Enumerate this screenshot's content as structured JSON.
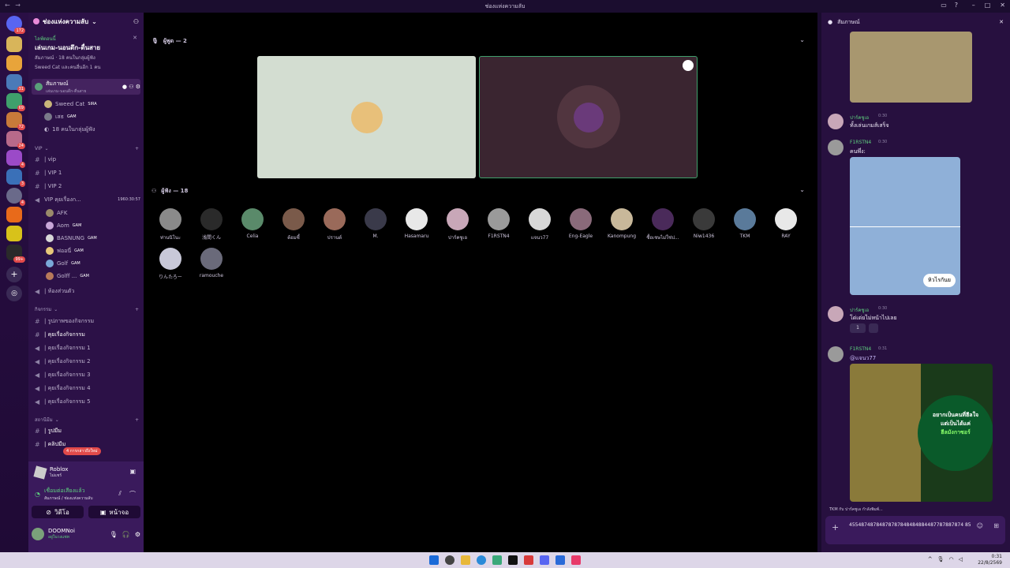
{
  "window": {
    "title": "ช่องแห่งความลับ"
  },
  "server": {
    "name": "ช่องแห่งความลับ",
    "event_tag": "ไลฟ์ตอนนี้",
    "event_title": "เล่นเกม-นอนดึก-ตื่นสาย",
    "event_meta": "สัมภาษณ์ · 18 คนในกลุ่มผู้ฟัง",
    "event_meta2": "Sweed Cat และคนอื่นอีก 1 คน"
  },
  "stage_channel": {
    "name": "สัมภาษณ์",
    "topic": "เล่นเกม-นอนดึก-ตื่นสาย",
    "members": [
      {
        "name": "Sweed Cat",
        "tag": "SIRA"
      },
      {
        "name": "เสธ",
        "tag": "GAM"
      },
      {
        "name": "18 คนในกลุ่มผู้ฟัง",
        "tag": ""
      }
    ]
  },
  "categories": [
    {
      "name": "VIP",
      "channels": [
        "| vip",
        "| VIP 1",
        "| VIP 2"
      ]
    },
    {
      "name": "กิจกรรม",
      "channels": [
        "| รูปภาพของกิจกรรม",
        "| คุยเรื่องกิจกรรม",
        "| คุยเรื่องกิจกรรม 1",
        "| คุยเรื่องกิจกรรม 2",
        "| คุยเรื่องกิจกรรม 3",
        "| คุยเรื่องกิจกรรม 4",
        "| คุยเรื่องกิจกรรม 5"
      ]
    },
    {
      "name": "สถานีมีม",
      "channels": [
        "| รูปมีม",
        "| คลิปมีม"
      ]
    }
  ],
  "vip_voice": {
    "name": "VIP คุยเรื่องก...",
    "timer": "1960:30:57",
    "members": [
      {
        "name": "AFK",
        "tag": ""
      },
      {
        "name": "Aom",
        "tag": "GAM"
      },
      {
        "name": "BASNUNG",
        "tag": "GAM"
      },
      {
        "name": "ฟออนี่",
        "tag": "GAM"
      },
      {
        "name": "Golf",
        "tag": "GAM"
      },
      {
        "name": "Golff ...",
        "tag": "GAM"
      }
    ],
    "private_room": "| ห้องส่วนตัว"
  },
  "new_mentions": "4 การกล่าวถึงใหม่",
  "activity": {
    "game": "Roblox",
    "sub": "ไม่แชร์"
  },
  "voice_status": {
    "title": "เชื่อมต่อเสียงแล้ว",
    "sub": "สัมภาษณ์ / ช่องแห่งความลับ"
  },
  "voice_buttons": {
    "video": "วิดีโอ",
    "screen": "หน้าจอ"
  },
  "user": {
    "name": "DOOMNoi",
    "status": "อยู่ในวงแชท"
  },
  "stage": {
    "speakers_label": "ผู้พูด — 2",
    "listeners_label": "ผู้ฟัง — 18",
    "listeners": [
      "ท่านนิโนะ",
      "浅間くん",
      "Celia",
      "ต้อมซี้",
      "ปรานต์",
      "M.",
      "Hasamaru",
      "ปาร์คชูเอ",
      "F1RSTN4",
      "แจนว77",
      "Eng-Eagle",
      "Kanompung",
      "ซื้อเชษไม่ใช่ป...",
      "Niw1436",
      "TKM",
      "RAY",
      "りんたろー",
      "ramouche"
    ]
  },
  "chat": {
    "title": "สัมภาษณ์",
    "messages": [
      {
        "author": "ปาร์คชูเอ",
        "time": "0:30",
        "text": "ทั้งเล่นเกมส์เสร็จ"
      },
      {
        "author": "F1RSTN4",
        "time": "0:30",
        "text": "คนพึ่ง:"
      },
      {
        "author": "ปาร์คชูเอ",
        "time": "0:30",
        "text": "โด่เด่ยไม่หน้าไปเลย"
      },
      {
        "author": "F1RSTN4",
        "time": "0:31",
        "text": "@แจนว77"
      }
    ],
    "meme_caption": "หิวไรกันย",
    "poster_text1": "อยากเป็นคนที่ฮีลใจ",
    "poster_text2": "แต่เป็นได้แค่",
    "poster_text3": "ฮีลมังกาซอร์",
    "reaction_count": "1",
    "typing": "TKM กับ ปาร์คชูเอ กำลังพิมพ์...",
    "input_value": "45548748784878787848484884487787887874 85"
  },
  "taskbar": {
    "time": "0:31",
    "date": "22/8/2569"
  }
}
